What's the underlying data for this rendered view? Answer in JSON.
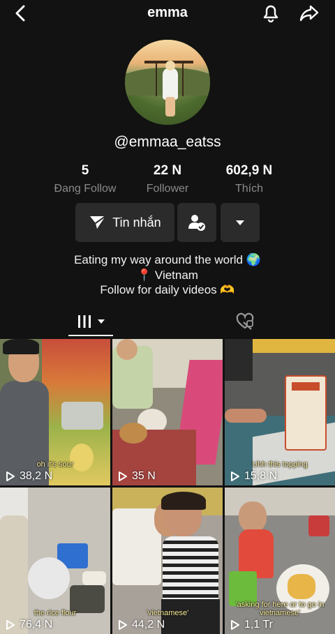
{
  "header": {
    "username": "emma"
  },
  "profile": {
    "handle": "@emmaa_eatss",
    "stats": [
      {
        "value": "5",
        "label": "Đang Follow"
      },
      {
        "value": "22 N",
        "label": "Follower"
      },
      {
        "value": "602,9 N",
        "label": "Thích"
      }
    ],
    "message_button": "Tin nhắn",
    "bio": [
      "Eating my way around the world 🌍",
      "📍 Vietnam",
      "Follow for daily videos 🫶"
    ]
  },
  "videos": [
    {
      "views": "38,2 N",
      "caption": "oh it's sour"
    },
    {
      "views": "35 N",
      "caption": ""
    },
    {
      "views": "15,8 N",
      "caption": "Uhh this topping"
    },
    {
      "views": "76,4 N",
      "caption": "the rice flour"
    },
    {
      "views": "44,2 N",
      "caption": "'vietnamese'"
    },
    {
      "views": "1,1 Tr",
      "caption": "'asking for here or to go in vietnamese'"
    }
  ]
}
